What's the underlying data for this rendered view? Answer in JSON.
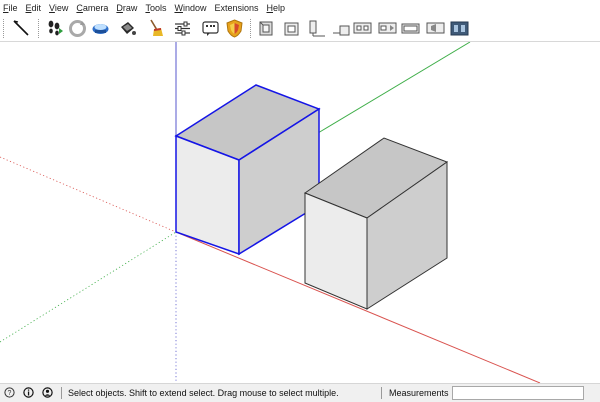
{
  "menu": {
    "items": [
      {
        "mnemonic": "F",
        "rest": "ile"
      },
      {
        "mnemonic": "E",
        "rest": "dit"
      },
      {
        "mnemonic": "V",
        "rest": "iew"
      },
      {
        "mnemonic": "C",
        "rest": "amera"
      },
      {
        "mnemonic": "D",
        "rest": "raw"
      },
      {
        "mnemonic": "T",
        "rest": "ools"
      },
      {
        "mnemonic": "W",
        "rest": "indow"
      },
      {
        "mnemonic": "",
        "rest": "Extensions"
      },
      {
        "mnemonic": "H",
        "rest": "elp"
      }
    ]
  },
  "toolbar": {
    "tools": [
      "select-tool-icon",
      "walk-tool-icon",
      "orbit-tool-icon",
      "push-pull-tool-icon",
      "paint-bucket-icon",
      "sweep-tool-icon",
      "layers-icon",
      "components-icon",
      "styles-icon",
      "iso-view-icon",
      "top-view-icon",
      "front-view-icon",
      "right-view-icon",
      "back-view-icon",
      "left-view-icon",
      "bottom-view-icon",
      "perspective-view-icon"
    ]
  },
  "viewport": {
    "axis_colors": {
      "red": "#d9534f",
      "green": "#3fae49",
      "blue": "#5757cc"
    },
    "selection_color": "#1515e6",
    "face_top_color": "#c6c6c6",
    "face_front_color": "#ececec",
    "face_side_color": "#cecece"
  },
  "status": {
    "icons": [
      "help-icon",
      "info-icon",
      "user-icon"
    ],
    "message": "Select objects. Shift to extend select. Drag mouse to select multiple.",
    "measurements_label": "Measurements",
    "measurements_value": ""
  }
}
